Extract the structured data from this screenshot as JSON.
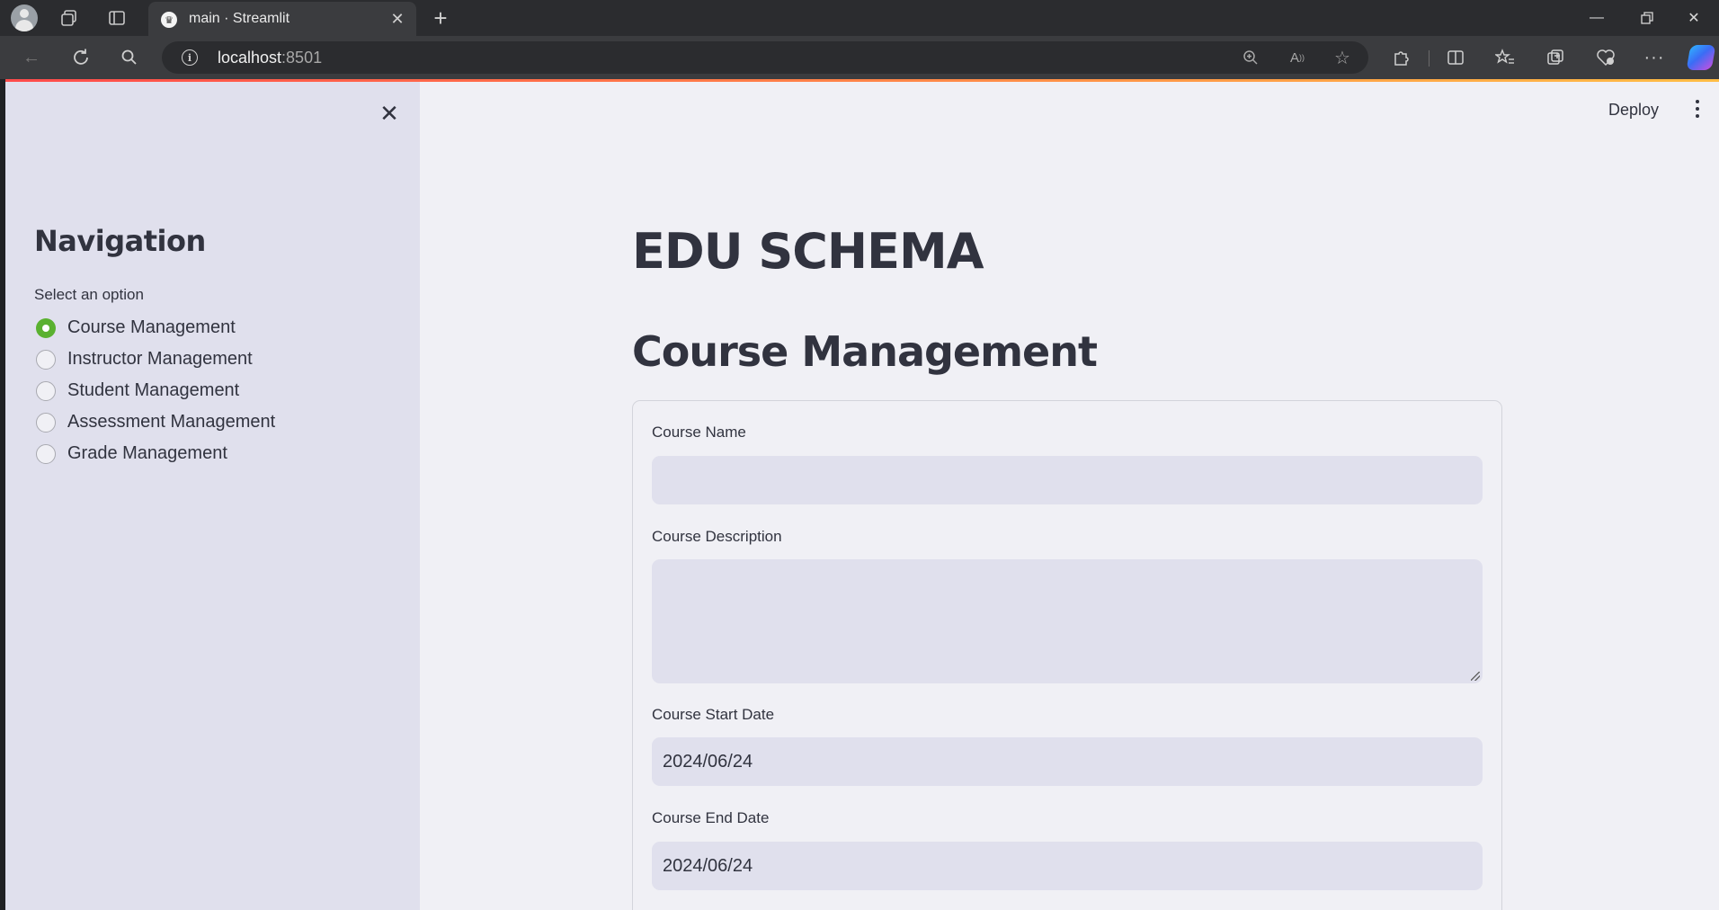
{
  "browser": {
    "tab_title": "main · Streamlit",
    "url_host": "localhost",
    "url_port": ":8501"
  },
  "header": {
    "deploy_label": "Deploy"
  },
  "sidebar": {
    "title": "Navigation",
    "radio_label": "Select an option",
    "options": [
      {
        "label": "Course Management",
        "selected": true
      },
      {
        "label": "Instructor Management",
        "selected": false
      },
      {
        "label": "Student Management",
        "selected": false
      },
      {
        "label": "Assessment Management",
        "selected": false
      },
      {
        "label": "Grade Management",
        "selected": false
      }
    ]
  },
  "main": {
    "app_title": "EDU SCHEMA",
    "section_title": "Course Management",
    "form": {
      "course_name": {
        "label": "Course Name",
        "value": ""
      },
      "course_description": {
        "label": "Course Description",
        "value": ""
      },
      "course_start_date": {
        "label": "Course Start Date",
        "value": "2024/06/24"
      },
      "course_end_date": {
        "label": "Course End Date",
        "value": "2024/06/24"
      }
    }
  },
  "colors": {
    "accent_radio": "#5ab130",
    "decoration_start": "#ff4b4b",
    "decoration_end": "#ffbd45",
    "text": "#31333f"
  }
}
